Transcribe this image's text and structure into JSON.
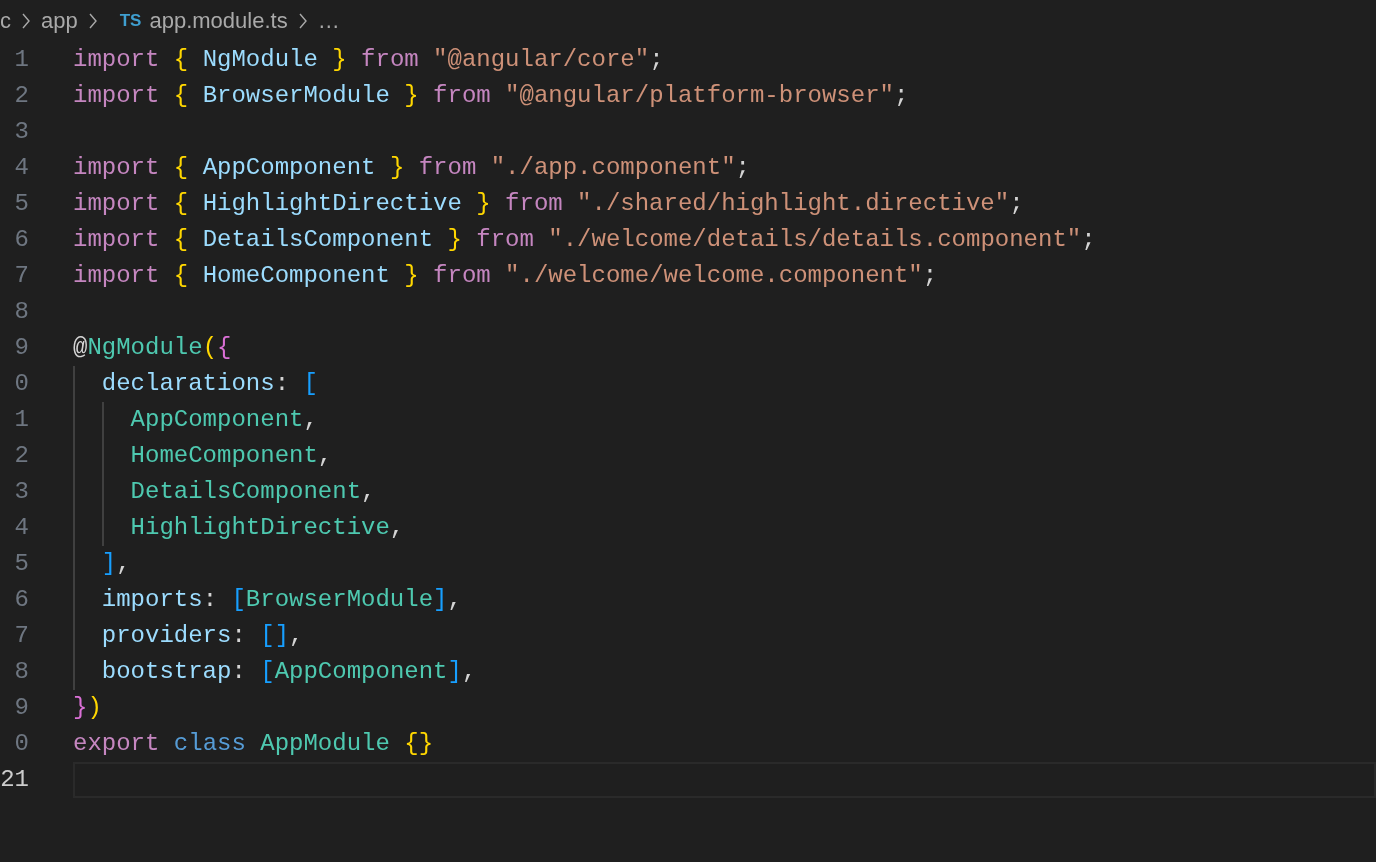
{
  "breadcrumb": {
    "items": [
      {
        "text": "c"
      },
      {
        "text": "app"
      },
      {
        "text": "app.module.ts",
        "badge": "TS"
      },
      {
        "text": "…"
      }
    ]
  },
  "editor": {
    "lines": [
      {
        "number": "1",
        "current": false,
        "tokens": [
          {
            "text": "import",
            "kind": "keyword"
          },
          {
            "text": " {",
            "kind": "brace"
          },
          {
            "text": " NgModule ",
            "kind": "variable"
          },
          {
            "text": "}",
            "kind": "brace"
          },
          {
            "text": " from",
            "kind": "keyword"
          },
          {
            "text": " \"@angular/core\"",
            "kind": "string"
          },
          {
            "text": ";",
            "kind": "punct"
          }
        ]
      },
      {
        "number": "2",
        "current": false,
        "tokens": [
          {
            "text": "import",
            "kind": "keyword"
          },
          {
            "text": " {",
            "kind": "brace"
          },
          {
            "text": " BrowserModule ",
            "kind": "variable"
          },
          {
            "text": "}",
            "kind": "brace"
          },
          {
            "text": " from",
            "kind": "keyword"
          },
          {
            "text": " \"@angular/platform-browser\"",
            "kind": "string"
          },
          {
            "text": ";",
            "kind": "punct"
          }
        ]
      },
      {
        "number": "3",
        "current": false
      },
      {
        "number": "4",
        "current": false,
        "tokens": [
          {
            "text": "import",
            "kind": "keyword"
          },
          {
            "text": " {",
            "kind": "brace"
          },
          {
            "text": " AppComponent ",
            "kind": "variable"
          },
          {
            "text": "}",
            "kind": "brace"
          },
          {
            "text": " from",
            "kind": "keyword"
          },
          {
            "text": " \"./app.component\"",
            "kind": "string"
          },
          {
            "text": ";",
            "kind": "punct"
          }
        ]
      },
      {
        "number": "5",
        "current": false,
        "tokens": [
          {
            "text": "import",
            "kind": "keyword"
          },
          {
            "text": " {",
            "kind": "brace"
          },
          {
            "text": " HighlightDirective ",
            "kind": "variable"
          },
          {
            "text": "}",
            "kind": "brace"
          },
          {
            "text": " from",
            "kind": "keyword"
          },
          {
            "text": " \"./shared/highlight.directive\"",
            "kind": "string"
          },
          {
            "text": ";",
            "kind": "punct"
          }
        ]
      },
      {
        "number": "6",
        "current": false,
        "tokens": [
          {
            "text": "import",
            "kind": "keyword"
          },
          {
            "text": " {",
            "kind": "brace"
          },
          {
            "text": " DetailsComponent ",
            "kind": "variable"
          },
          {
            "text": "}",
            "kind": "brace"
          },
          {
            "text": " from",
            "kind": "keyword"
          },
          {
            "text": " \"./welcome/details/details.component\"",
            "kind": "string"
          },
          {
            "text": ";",
            "kind": "punct"
          }
        ]
      },
      {
        "number": "7",
        "current": false,
        "tokens": [
          {
            "text": "import",
            "kind": "keyword"
          },
          {
            "text": " {",
            "kind": "brace"
          },
          {
            "text": " HomeComponent ",
            "kind": "variable"
          },
          {
            "text": "}",
            "kind": "brace"
          },
          {
            "text": " from",
            "kind": "keyword"
          },
          {
            "text": " \"./welcome/welcome.component\"",
            "kind": "string"
          },
          {
            "text": ";",
            "kind": "punct"
          }
        ]
      },
      {
        "number": "8",
        "current": false
      },
      {
        "number": "9",
        "current": false,
        "tokens": [
          {
            "text": "@",
            "kind": "punct"
          },
          {
            "text": "NgModule",
            "kind": "type"
          },
          {
            "text": "(",
            "kind": "brace"
          },
          {
            "text": "{",
            "kind": "brace2"
          }
        ]
      },
      {
        "number": "0",
        "current": false,
        "tokens": [
          {
            "text": "  declarations",
            "kind": "variable"
          },
          {
            "text": ":",
            "kind": "punct"
          },
          {
            "text": " [",
            "kind": "brace3"
          }
        ]
      },
      {
        "number": "1",
        "current": false,
        "tokens": [
          {
            "text": "    AppComponent",
            "kind": "type"
          },
          {
            "text": ",",
            "kind": "punct"
          }
        ]
      },
      {
        "number": "2",
        "current": false,
        "tokens": [
          {
            "text": "    HomeComponent",
            "kind": "type"
          },
          {
            "text": ",",
            "kind": "punct"
          }
        ]
      },
      {
        "number": "3",
        "current": false,
        "tokens": [
          {
            "text": "    DetailsComponent",
            "kind": "type"
          },
          {
            "text": ",",
            "kind": "punct"
          }
        ]
      },
      {
        "number": "4",
        "current": false,
        "tokens": [
          {
            "text": "    HighlightDirective",
            "kind": "type"
          },
          {
            "text": ",",
            "kind": "punct"
          }
        ]
      },
      {
        "number": "5",
        "current": false,
        "tokens": [
          {
            "text": "  ]",
            "kind": "brace3"
          },
          {
            "text": ",",
            "kind": "punct"
          }
        ]
      },
      {
        "number": "6",
        "current": false,
        "tokens": [
          {
            "text": "  imports",
            "kind": "variable"
          },
          {
            "text": ":",
            "kind": "punct"
          },
          {
            "text": " [",
            "kind": "brace3"
          },
          {
            "text": "BrowserModule",
            "kind": "type"
          },
          {
            "text": "]",
            "kind": "brace3"
          },
          {
            "text": ",",
            "kind": "punct"
          }
        ]
      },
      {
        "number": "7",
        "current": false,
        "tokens": [
          {
            "text": "  providers",
            "kind": "variable"
          },
          {
            "text": ":",
            "kind": "punct"
          },
          {
            "text": " []",
            "kind": "brace3"
          },
          {
            "text": ",",
            "kind": "punct"
          }
        ]
      },
      {
        "number": "8",
        "current": false,
        "tokens": [
          {
            "text": "  bootstrap",
            "kind": "variable"
          },
          {
            "text": ":",
            "kind": "punct"
          },
          {
            "text": " [",
            "kind": "brace3"
          },
          {
            "text": "AppComponent",
            "kind": "type"
          },
          {
            "text": "]",
            "kind": "brace3"
          },
          {
            "text": ",",
            "kind": "punct"
          }
        ]
      },
      {
        "number": "9",
        "current": false,
        "tokens": [
          {
            "text": "}",
            "kind": "brace2"
          },
          {
            "text": ")",
            "kind": "brace"
          }
        ]
      },
      {
        "number": "0",
        "current": false,
        "tokens": [
          {
            "text": "export",
            "kind": "keyword"
          },
          {
            "text": " class",
            "kind": "storage"
          },
          {
            "text": " AppModule",
            "kind": "type"
          },
          {
            "text": " {}",
            "kind": "brace"
          }
        ]
      },
      {
        "number": "21",
        "current": true
      }
    ]
  }
}
